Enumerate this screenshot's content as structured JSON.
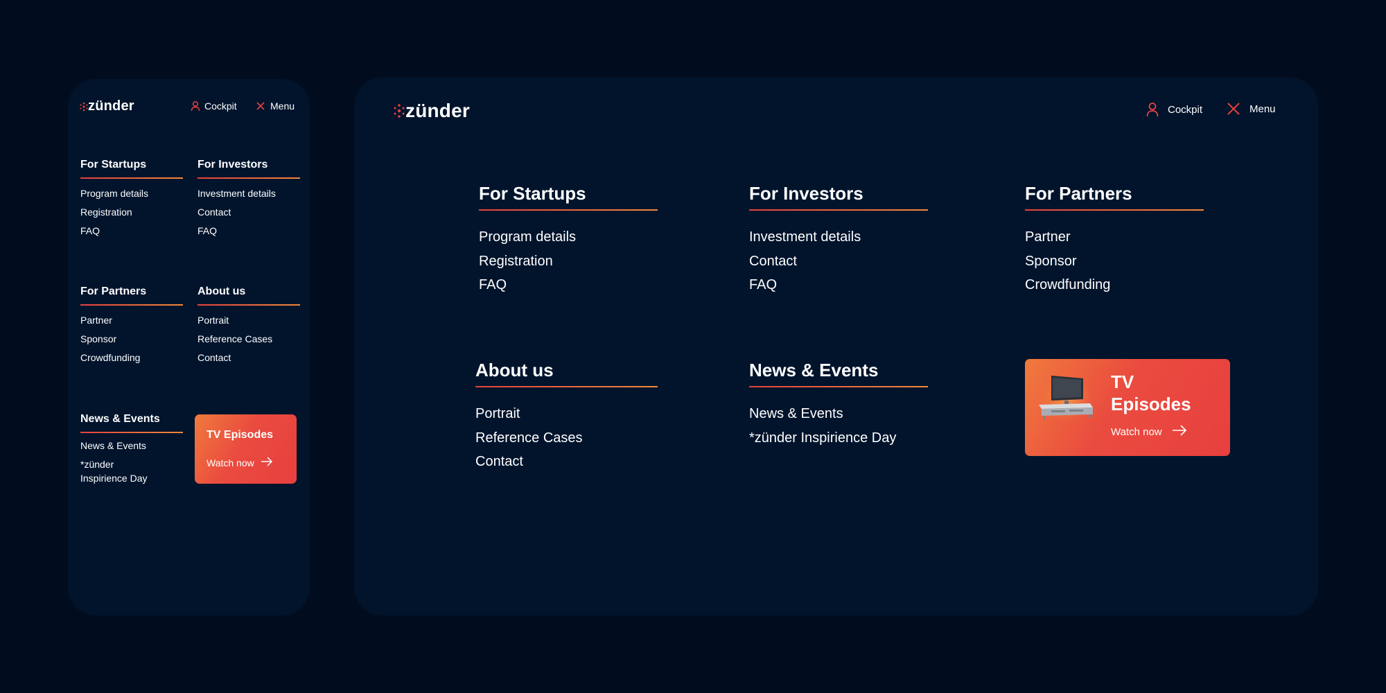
{
  "brand": {
    "name": "zünder",
    "accent": "#e8413d",
    "accent_end": "#f28a3b",
    "background": "#020c1f",
    "panel": "#01142c"
  },
  "header": {
    "cockpit_label": "Cockpit",
    "cockpit_icon": "user-icon",
    "menu_label": "Menu",
    "menu_icon": "close-icon"
  },
  "sections": {
    "startups": {
      "title": "For Startups",
      "links": [
        "Program details",
        "Registration",
        "FAQ"
      ]
    },
    "investors": {
      "title": "For Investors",
      "links": [
        "Investment details",
        "Contact",
        "FAQ"
      ]
    },
    "partners": {
      "title": "For Partners",
      "links": [
        "Partner",
        "Sponsor",
        "Crowdfunding"
      ]
    },
    "about": {
      "title": "About us",
      "links": [
        "Portrait",
        "Reference Cases",
        "Contact"
      ]
    },
    "news": {
      "title": "News & Events",
      "links": [
        "News & Events",
        "*zünder Inspirience Day"
      ]
    },
    "news_mobile": {
      "links": [
        "News & Events",
        "*zünder",
        "Inspirience Day"
      ]
    }
  },
  "tv_card": {
    "title": "TV Episodes",
    "title_line1": "TV",
    "title_line2": "Episodes",
    "cta": "Watch now",
    "cta_icon": "arrow-right-icon",
    "image_icon": "tv-icon"
  }
}
